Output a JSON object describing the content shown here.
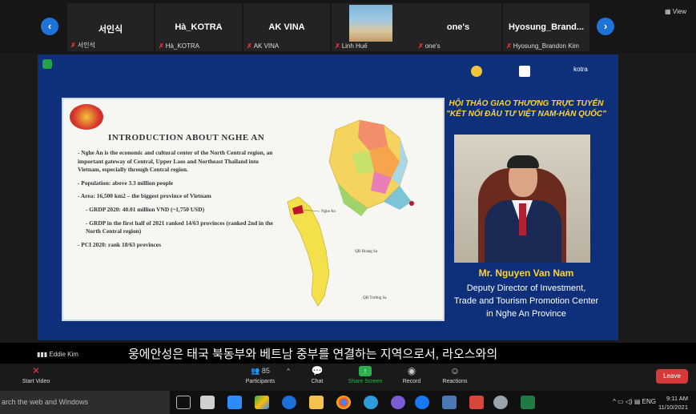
{
  "participants": [
    {
      "name": "서인식",
      "label": "서인석"
    },
    {
      "name": "Hà_KOTRA",
      "label": "Hà_KOTRA"
    },
    {
      "name": "AK VINA",
      "label": "AK VINA"
    },
    {
      "name": "",
      "label": "Linh Huế"
    },
    {
      "name": "one's",
      "label": "one's"
    },
    {
      "name": "Hyosung_Brand...",
      "label": "Hyosung_Brandon Kim"
    }
  ],
  "view_label": "View",
  "slide": {
    "title": "INTRODUCTION ABOUT NGHE AN",
    "bullets": [
      "- Nghe An is the economic and cultural center of the North Central region, an important gateway of Central, Upper Laos and Northeast Thailand into Vietnam, especially through Central region.",
      "- Population: above 3.3 million people",
      "- Area: 16,500 km2 – the biggest province of Vietnam",
      "- GRDP 2020: 40.01 million VND (~1,750 USD)",
      "- GRDP in the first half of 2021 ranked 14/63 provinces (ranked 2nd in the North Central region)",
      "- PCI 2020: rank 18/63 provinces"
    ],
    "map_labels": {
      "nghe_an": "Nghe An",
      "hoang_sa": "QĐ Hoàng Sa",
      "truong_sa": "QĐ Trường Sa"
    }
  },
  "event": {
    "logos": [
      "",
      "",
      "kotra"
    ],
    "title_line1": "HỘI THẢO GIAO THƯƠNG TRỰC TUYẾN",
    "title_line2": "\"KẾT NỐI ĐẦU TƯ VIỆT NAM-HÀN QUỐC\""
  },
  "speaker": {
    "name": "Mr. Nguyen Van Nam",
    "role_lines": [
      "Deputy Director of Investment,",
      "Trade and Tourism Promotion Center",
      "in Nghe An Province"
    ]
  },
  "caption": {
    "speaker": "Eddie Kim",
    "text": "웅에안성은 태국 북동부와 베트남 중부를 연결하는 지역으로서, 라오스와의"
  },
  "toolbar": {
    "start_video": "Start Video",
    "participants": "Participants",
    "participants_count": "85",
    "chat": "Chat",
    "share_screen": "Share Screen",
    "record": "Record",
    "reactions": "Reactions",
    "leave": "Leave"
  },
  "taskbar": {
    "search": "arch the web and Windows",
    "lang": "ENG",
    "time": "9:11 AM",
    "date": "11/10/2021"
  },
  "colors": {
    "accent": "#1e73d8",
    "leave": "#d43a3a",
    "share_green": "#2bb24c",
    "title_yellow": "#ffd42a",
    "slide_bg": "#0e2f7a"
  }
}
